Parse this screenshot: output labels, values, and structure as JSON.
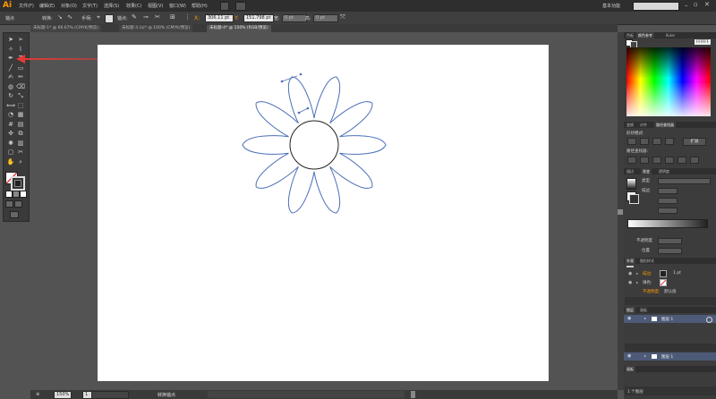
{
  "app": {
    "logo": "Ai",
    "workspace": "基本功能",
    "search_placeholder": ""
  },
  "menu": [
    "文件(F)",
    "编辑(E)",
    "对象(O)",
    "文字(T)",
    "选择(S)",
    "效果(C)",
    "视图(V)",
    "窗口(W)",
    "帮助(H)"
  ],
  "controlbar": {
    "mode_label": "锚点",
    "convert_label": "转换:",
    "handles_label": "手柄:",
    "anchor_label": "锚点:",
    "x_label": "X:",
    "x_value": "306.11 pt",
    "y_label": "Y:",
    "y_value": "151.798 pt",
    "w_label": "宽:",
    "w_value": "0 pt",
    "h_label": "高:",
    "h_value": "0 pt"
  },
  "tabs": [
    {
      "label": "未标题-1* @ 66.67% (CMYK/预览)",
      "active": false
    },
    {
      "label": "未标题-3 (a)* @ 100% (CMYK/预览)",
      "active": false
    },
    {
      "label": "未标题-4* @ 150% (RGB/预览)",
      "active": true
    }
  ],
  "tools": [
    "selection-tool",
    "direct-selection-tool",
    "magic-wand-tool",
    "lasso-tool",
    "pen-tool",
    "type-tool",
    "line-tool",
    "rectangle-tool",
    "paintbrush-tool",
    "pencil-tool",
    "blob-brush-tool",
    "eraser-tool",
    "rotate-tool",
    "scale-tool",
    "width-tool",
    "free-transform-tool",
    "shape-builder-tool",
    "perspective-grid-tool",
    "mesh-tool",
    "gradient-tool",
    "eyedropper-tool",
    "blend-tool",
    "symbol-sprayer-tool",
    "column-graph-tool",
    "artboard-tool",
    "slice-tool",
    "hand-tool",
    "zoom-tool"
  ],
  "colors": {
    "accent": "#ff9a00",
    "path_blue": "#4a6fb8",
    "arrow_red": "#e53935",
    "layer_highlight": "#4d5a78"
  },
  "panels": {
    "color": {
      "tabs": [
        "色板",
        "颜色参考",
        "Kuler"
      ],
      "hex_value": "FFFFFF"
    },
    "pathfinder": {
      "tabs": [
        "变换",
        "对齐",
        "路径查找器"
      ],
      "shape_modes_label": "形状模式:",
      "pathfinder_label": "路径查找器:",
      "expand_label": "扩展"
    },
    "gradient": {
      "tabs": [
        "描边",
        "渐变",
        "透明度"
      ],
      "type_label": "类型",
      "stroke_label": "描边",
      "opacity_label": "不透明度",
      "location_label": "位置"
    },
    "appearance": {
      "tabs": [
        "外观",
        "图形样式"
      ],
      "stroke_label": "描边:",
      "stroke_value": "1 pt",
      "fill_label": "填色:",
      "opacity_label": "不透明度:",
      "opacity_value": "默认值"
    },
    "layers": {
      "tabs": [
        "图层",
        "画板"
      ],
      "layer_name": "图层 1",
      "status": "1 个图层"
    },
    "layers2": {
      "layer_name": "图层 1"
    },
    "artboards_tab": "画板"
  },
  "status": {
    "zoom": "150%",
    "page": "1",
    "tool_name": "转换锚点"
  }
}
